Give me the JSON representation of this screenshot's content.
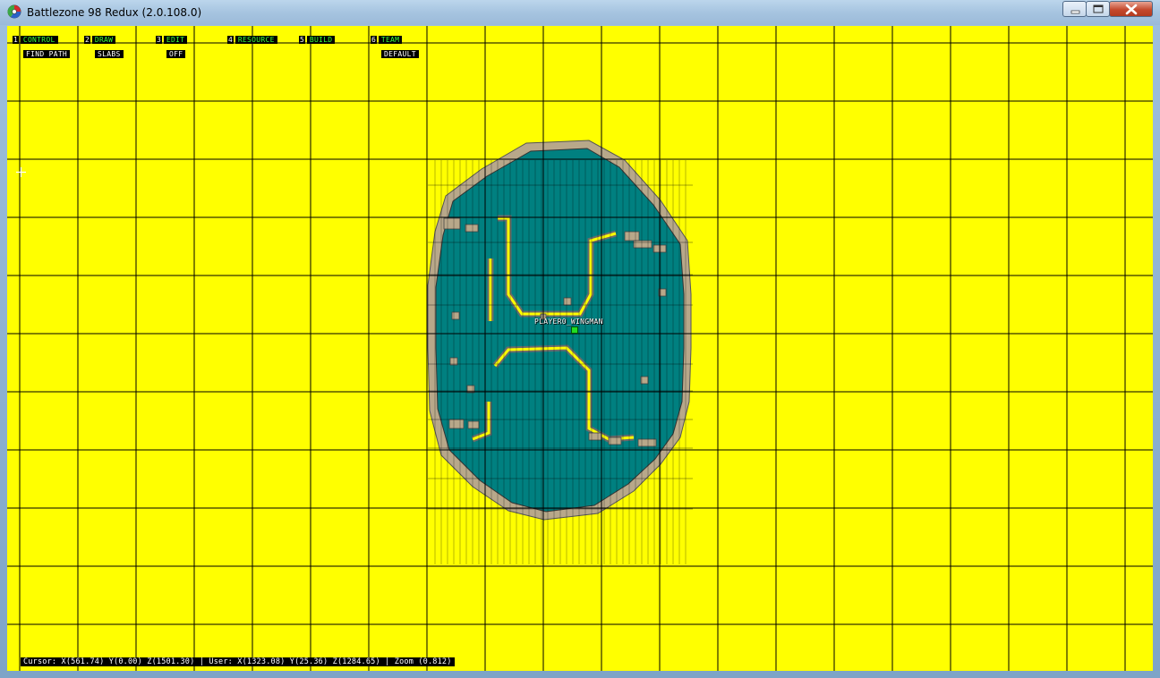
{
  "window": {
    "title": "Battlezone 98 Redux (2.0.108.0)"
  },
  "menu": {
    "items": [
      {
        "num": "1",
        "label": "Control",
        "value": "Find Path"
      },
      {
        "num": "2",
        "label": "Draw",
        "value": "Slabs"
      },
      {
        "num": "3",
        "label": "Edit",
        "value": "Off"
      },
      {
        "num": "4",
        "label": "Resource",
        "value": ""
      },
      {
        "num": "5",
        "label": "Build",
        "value": ""
      },
      {
        "num": "6",
        "label": "Team",
        "value": "Default"
      }
    ]
  },
  "map": {
    "unit_label": "player0_wingman"
  },
  "status_bar": {
    "text": "Cursor: X(561.74) Y(0.00) Z(1501.30) | User: X(1323.08) Y(25.36) Z(1284.65) | Zoom (0.812)"
  },
  "colors": {
    "background": "#ffff00",
    "water": "#008080",
    "slope": "#b8a88a",
    "grid": "#000000",
    "hud_label": "#39ff39"
  },
  "icons": [
    "app-icon",
    "minimize-icon",
    "maximize-icon",
    "close-icon",
    "crosshair-icon"
  ]
}
